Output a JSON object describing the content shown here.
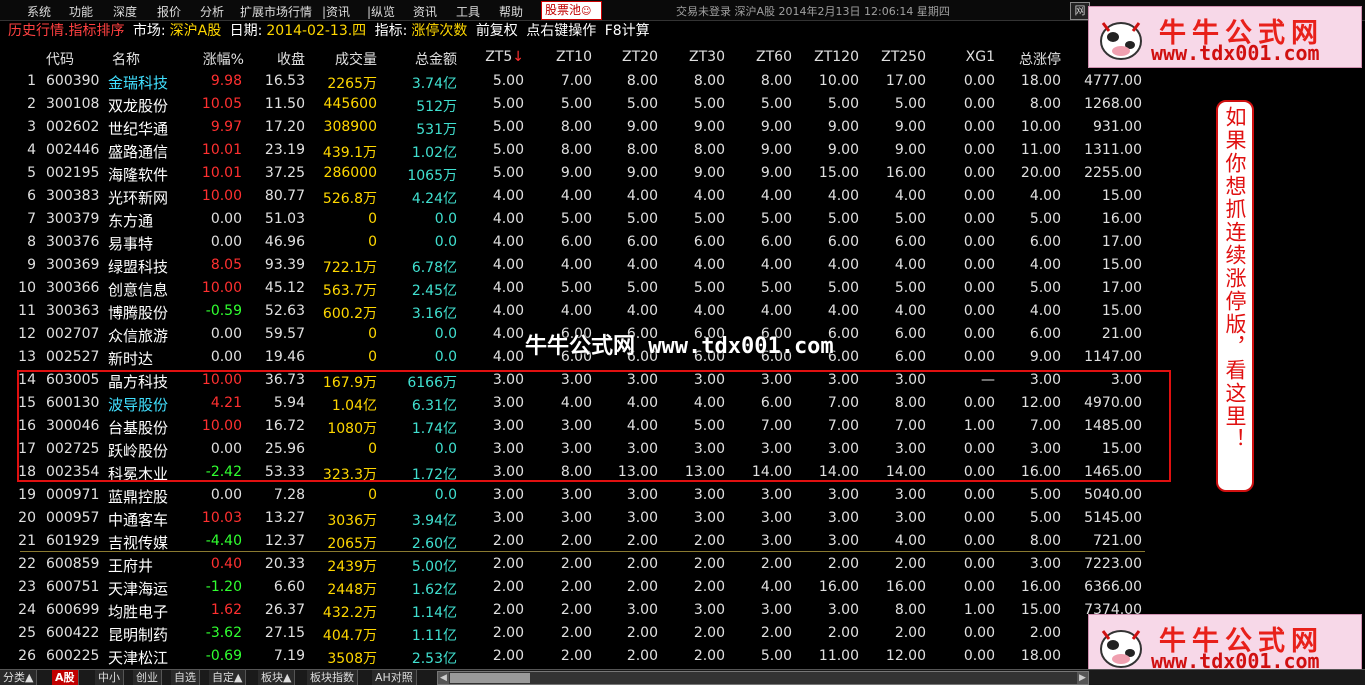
{
  "menu": {
    "items": [
      "系统",
      "功能",
      "深度",
      "报价",
      "分析",
      "扩展市场行情",
      "|资讯",
      "|纵览",
      "资讯",
      "工具",
      "帮助"
    ],
    "stock_pool": "股票池",
    "status": "交易未登录   深沪A股   2014年2月13日  12:06:14  星期四",
    "window_button": "网"
  },
  "titlebar": {
    "view": "历史行情.指标排序",
    "market_label": "市场:",
    "market": "深沪A股",
    "date_label": "日期:",
    "date": "2014-02-13.四",
    "indicator_label": "指标:",
    "indicator": "涨停次数",
    "rights": "前复权",
    "hint": "点右键操作",
    "calc": "F8计算"
  },
  "columns": [
    "代码",
    "名称",
    "涨幅%",
    "收盘",
    "成交量",
    "总金额",
    "ZT5",
    "ZT10",
    "ZT20",
    "ZT30",
    "ZT60",
    "ZT120",
    "ZT250",
    "XG1",
    "总涨停",
    "_"
  ],
  "sort_indicator": "↓",
  "rows": [
    {
      "idx": "1",
      "code": "600390",
      "name": "金瑞科技",
      "name_color": "cyan",
      "chg": "9.98",
      "dir": "up",
      "close": "16.53",
      "vol": "2265万",
      "amt": "3.74亿",
      "zt": [
        "5.00",
        "7.00",
        "8.00",
        "8.00",
        "8.00",
        "10.00",
        "17.00"
      ],
      "xg1": "0.00",
      "total": "18.00",
      "last": "4777.00"
    },
    {
      "idx": "2",
      "code": "300108",
      "name": "双龙股份",
      "name_color": "white",
      "chg": "10.05",
      "dir": "up",
      "close": "11.50",
      "vol": "445600",
      "amt": "512万",
      "zt": [
        "5.00",
        "5.00",
        "5.00",
        "5.00",
        "5.00",
        "5.00",
        "5.00"
      ],
      "xg1": "0.00",
      "total": "8.00",
      "last": "1268.00"
    },
    {
      "idx": "3",
      "code": "002602",
      "name": "世纪华通",
      "name_color": "white",
      "chg": "9.97",
      "dir": "up",
      "close": "17.20",
      "vol": "308900",
      "amt": "531万",
      "zt": [
        "5.00",
        "8.00",
        "9.00",
        "9.00",
        "9.00",
        "9.00",
        "9.00"
      ],
      "xg1": "0.00",
      "total": "10.00",
      "last": "931.00"
    },
    {
      "idx": "4",
      "code": "002446",
      "name": "盛路通信",
      "name_color": "white",
      "chg": "10.01",
      "dir": "up",
      "close": "23.19",
      "vol": "439.1万",
      "amt": "1.02亿",
      "zt": [
        "5.00",
        "8.00",
        "8.00",
        "8.00",
        "9.00",
        "9.00",
        "9.00"
      ],
      "xg1": "0.00",
      "total": "11.00",
      "last": "1311.00"
    },
    {
      "idx": "5",
      "code": "002195",
      "name": "海隆软件",
      "name_color": "white",
      "chg": "10.01",
      "dir": "up",
      "close": "37.25",
      "vol": "286000",
      "amt": "1065万",
      "zt": [
        "5.00",
        "9.00",
        "9.00",
        "9.00",
        "9.00",
        "15.00",
        "16.00"
      ],
      "xg1": "0.00",
      "total": "20.00",
      "last": "2255.00"
    },
    {
      "idx": "6",
      "code": "300383",
      "name": "光环新网",
      "name_color": "white",
      "chg": "10.00",
      "dir": "up",
      "close": "80.77",
      "vol": "526.8万",
      "amt": "4.24亿",
      "zt": [
        "4.00",
        "4.00",
        "4.00",
        "4.00",
        "4.00",
        "4.00",
        "4.00"
      ],
      "xg1": "0.00",
      "total": "4.00",
      "last": "15.00"
    },
    {
      "idx": "7",
      "code": "300379",
      "name": "东方通",
      "name_color": "white",
      "chg": "0.00",
      "dir": "flat",
      "close": "51.03",
      "vol": "0",
      "amt": "0.0",
      "zt": [
        "4.00",
        "5.00",
        "5.00",
        "5.00",
        "5.00",
        "5.00",
        "5.00"
      ],
      "xg1": "0.00",
      "total": "5.00",
      "last": "16.00"
    },
    {
      "idx": "8",
      "code": "300376",
      "name": "易事特",
      "name_color": "white",
      "chg": "0.00",
      "dir": "flat",
      "close": "46.96",
      "vol": "0",
      "amt": "0.0",
      "zt": [
        "4.00",
        "6.00",
        "6.00",
        "6.00",
        "6.00",
        "6.00",
        "6.00"
      ],
      "xg1": "0.00",
      "total": "6.00",
      "last": "17.00"
    },
    {
      "idx": "9",
      "code": "300369",
      "name": "绿盟科技",
      "name_color": "white",
      "chg": "8.05",
      "dir": "up",
      "close": "93.39",
      "vol": "722.1万",
      "amt": "6.78亿",
      "zt": [
        "4.00",
        "4.00",
        "4.00",
        "4.00",
        "4.00",
        "4.00",
        "4.00"
      ],
      "xg1": "0.00",
      "total": "4.00",
      "last": "15.00"
    },
    {
      "idx": "10",
      "code": "300366",
      "name": "创意信息",
      "name_color": "white",
      "chg": "10.00",
      "dir": "up",
      "close": "45.12",
      "vol": "563.7万",
      "amt": "2.45亿",
      "zt": [
        "4.00",
        "5.00",
        "5.00",
        "5.00",
        "5.00",
        "5.00",
        "5.00"
      ],
      "xg1": "0.00",
      "total": "5.00",
      "last": "17.00"
    },
    {
      "idx": "11",
      "code": "300363",
      "name": "博腾股份",
      "name_color": "white",
      "chg": "-0.59",
      "dir": "down",
      "close": "52.63",
      "vol": "600.2万",
      "amt": "3.16亿",
      "zt": [
        "4.00",
        "4.00",
        "4.00",
        "4.00",
        "4.00",
        "4.00",
        "4.00"
      ],
      "xg1": "0.00",
      "total": "4.00",
      "last": "15.00"
    },
    {
      "idx": "12",
      "code": "002707",
      "name": "众信旅游",
      "name_color": "white",
      "chg": "0.00",
      "dir": "flat",
      "close": "59.57",
      "vol": "0",
      "amt": "0.0",
      "zt": [
        "4.00",
        "6.00",
        "6.00",
        "6.00",
        "6.00",
        "6.00",
        "6.00"
      ],
      "xg1": "0.00",
      "total": "6.00",
      "last": "21.00"
    },
    {
      "idx": "13",
      "code": "002527",
      "name": "新时达",
      "name_color": "white",
      "chg": "0.00",
      "dir": "flat",
      "close": "19.46",
      "vol": "0",
      "amt": "0.0",
      "zt": [
        "4.00",
        "6.00",
        "6.00",
        "6.00",
        "6.00",
        "6.00",
        "6.00"
      ],
      "xg1": "0.00",
      "total": "9.00",
      "last": "1147.00"
    },
    {
      "idx": "14",
      "code": "603005",
      "name": "晶方科技",
      "name_color": "white",
      "chg": "10.00",
      "dir": "up",
      "close": "36.73",
      "vol": "167.9万",
      "amt": "6166万",
      "zt": [
        "3.00",
        "3.00",
        "3.00",
        "3.00",
        "3.00",
        "3.00",
        "3.00"
      ],
      "xg1": "—",
      "total": "3.00",
      "last": "3.00"
    },
    {
      "idx": "15",
      "code": "600130",
      "name": "波导股份",
      "name_color": "cyan",
      "chg": "4.21",
      "dir": "up",
      "close": "5.94",
      "vol": "1.04亿",
      "amt": "6.31亿",
      "zt": [
        "3.00",
        "4.00",
        "4.00",
        "4.00",
        "6.00",
        "7.00",
        "8.00"
      ],
      "xg1": "0.00",
      "total": "12.00",
      "last": "4970.00"
    },
    {
      "idx": "16",
      "code": "300046",
      "name": "台基股份",
      "name_color": "white",
      "chg": "10.00",
      "dir": "up",
      "close": "16.72",
      "vol": "1080万",
      "amt": "1.74亿",
      "zt": [
        "3.00",
        "3.00",
        "4.00",
        "5.00",
        "7.00",
        "7.00",
        "7.00"
      ],
      "xg1": "1.00",
      "total": "7.00",
      "last": "1485.00"
    },
    {
      "idx": "17",
      "code": "002725",
      "name": "跃岭股份",
      "name_color": "white",
      "chg": "0.00",
      "dir": "flat",
      "close": "25.96",
      "vol": "0",
      "amt": "0.0",
      "zt": [
        "3.00",
        "3.00",
        "3.00",
        "3.00",
        "3.00",
        "3.00",
        "3.00"
      ],
      "xg1": "0.00",
      "total": "3.00",
      "last": "15.00"
    },
    {
      "idx": "18",
      "code": "002354",
      "name": "科冕木业",
      "name_color": "white",
      "chg": "-2.42",
      "dir": "down",
      "close": "53.33",
      "vol": "323.3万",
      "amt": "1.72亿",
      "zt": [
        "3.00",
        "8.00",
        "13.00",
        "13.00",
        "14.00",
        "14.00",
        "14.00"
      ],
      "xg1": "0.00",
      "total": "16.00",
      "last": "1465.00"
    },
    {
      "idx": "19",
      "code": "000971",
      "name": "蓝鼎控股",
      "name_color": "white",
      "chg": "0.00",
      "dir": "flat",
      "close": "7.28",
      "vol": "0",
      "amt": "0.0",
      "zt": [
        "3.00",
        "3.00",
        "3.00",
        "3.00",
        "3.00",
        "3.00",
        "3.00"
      ],
      "xg1": "0.00",
      "total": "5.00",
      "last": "5040.00"
    },
    {
      "idx": "20",
      "code": "000957",
      "name": "中通客车",
      "name_color": "white",
      "chg": "10.03",
      "dir": "up",
      "close": "13.27",
      "vol": "3036万",
      "amt": "3.94亿",
      "zt": [
        "3.00",
        "3.00",
        "3.00",
        "3.00",
        "3.00",
        "3.00",
        "3.00"
      ],
      "xg1": "0.00",
      "total": "5.00",
      "last": "5145.00"
    },
    {
      "idx": "21",
      "code": "601929",
      "name": "吉视传媒",
      "name_color": "white",
      "chg": "-4.40",
      "dir": "down",
      "close": "12.37",
      "vol": "2065万",
      "amt": "2.60亿",
      "zt": [
        "2.00",
        "2.00",
        "2.00",
        "2.00",
        "3.00",
        "3.00",
        "4.00"
      ],
      "xg1": "0.00",
      "total": "8.00",
      "last": "721.00"
    },
    {
      "idx": "22",
      "code": "600859",
      "name": "王府井",
      "name_color": "white",
      "chg": "0.40",
      "dir": "up",
      "close": "20.33",
      "vol": "2439万",
      "amt": "5.00亿",
      "zt": [
        "2.00",
        "2.00",
        "2.00",
        "2.00",
        "2.00",
        "2.00",
        "2.00"
      ],
      "xg1": "0.00",
      "total": "3.00",
      "last": "7223.00"
    },
    {
      "idx": "23",
      "code": "600751",
      "name": "天津海运",
      "name_color": "white",
      "chg": "-1.20",
      "dir": "down",
      "close": "6.60",
      "vol": "2448万",
      "amt": "1.62亿",
      "zt": [
        "2.00",
        "2.00",
        "2.00",
        "2.00",
        "4.00",
        "16.00",
        "16.00"
      ],
      "xg1": "0.00",
      "total": "16.00",
      "last": "6366.00"
    },
    {
      "idx": "24",
      "code": "600699",
      "name": "均胜电子",
      "name_color": "white",
      "chg": "1.62",
      "dir": "up",
      "close": "26.37",
      "vol": "432.2万",
      "amt": "1.14亿",
      "zt": [
        "2.00",
        "2.00",
        "3.00",
        "3.00",
        "3.00",
        "3.00",
        "8.00"
      ],
      "xg1": "1.00",
      "total": "15.00",
      "last": "7374.00"
    },
    {
      "idx": "25",
      "code": "600422",
      "name": "昆明制药",
      "name_color": "white",
      "chg": "-3.62",
      "dir": "down",
      "close": "27.15",
      "vol": "404.7万",
      "amt": "1.11亿",
      "zt": [
        "2.00",
        "2.00",
        "2.00",
        "2.00",
        "2.00",
        "2.00",
        "2.00"
      ],
      "xg1": "0.00",
      "total": "2.00",
      "last": "2.00"
    },
    {
      "idx": "26",
      "code": "600225",
      "name": "天津松江",
      "name_color": "white",
      "chg": "-0.69",
      "dir": "down",
      "close": "7.19",
      "vol": "3508万",
      "amt": "2.53亿",
      "zt": [
        "2.00",
        "2.00",
        "2.00",
        "2.00",
        "5.00",
        "11.00",
        "12.00"
      ],
      "xg1": "0.00",
      "total": "18.00",
      "last": ""
    }
  ],
  "watermark": "牛牛公式网 www.tdx001.com",
  "logo": {
    "title": "牛牛公式网",
    "url": "www.tdx001.com"
  },
  "note": "如果你想抓连续涨停版，看这里！",
  "bottom_tabs": [
    "分类▲",
    "A股",
    "中小",
    "创业",
    "自选",
    "自定▲",
    "板块▲",
    "板块指数",
    "AH对照"
  ],
  "colors": {
    "up": "#ff3030",
    "down": "#30ff30",
    "highlight": "#e01010",
    "volume": "#ffd700",
    "amount": "#40e0d0"
  }
}
